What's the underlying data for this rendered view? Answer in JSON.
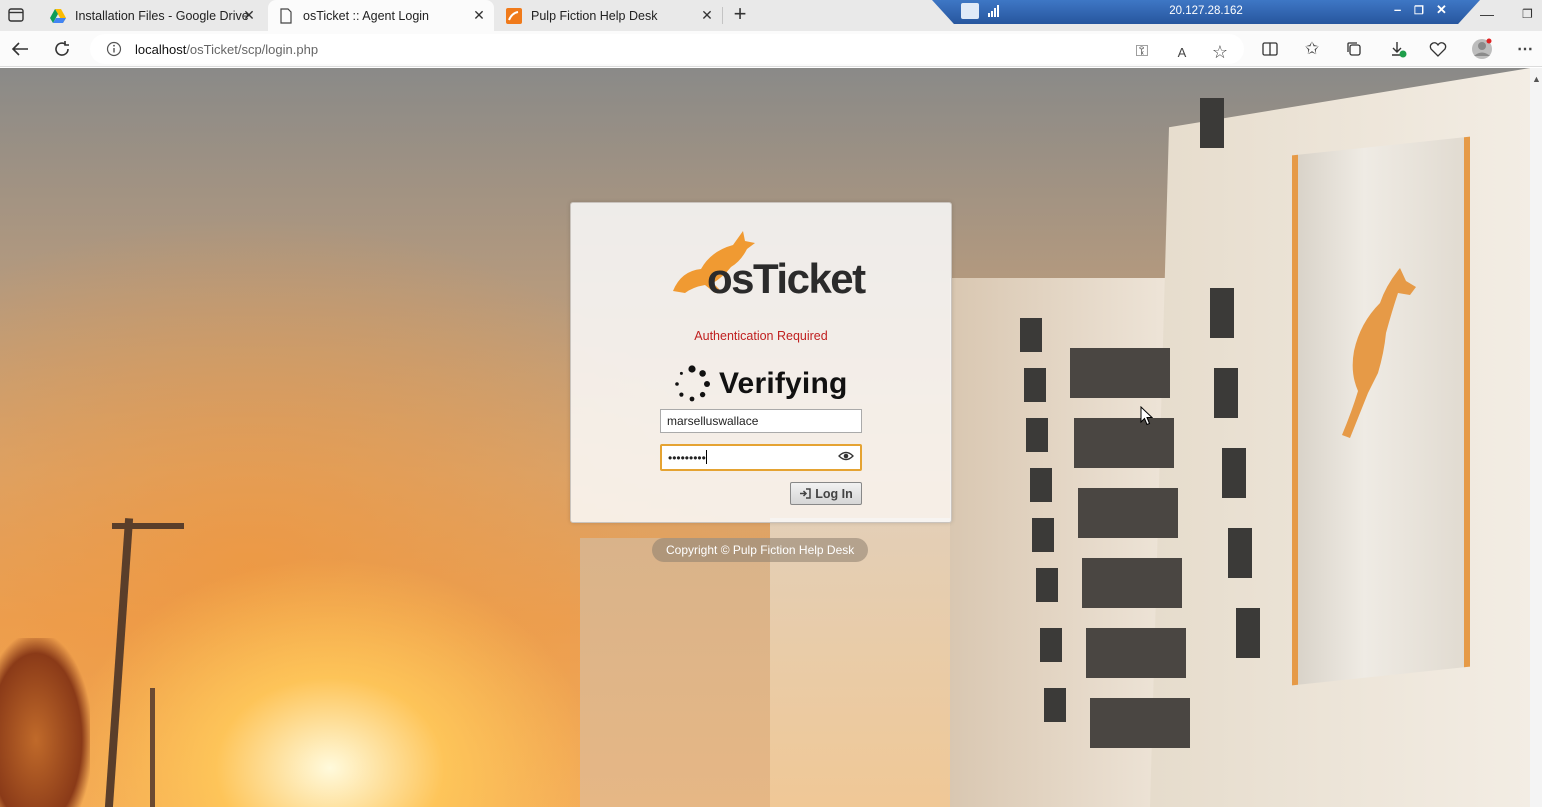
{
  "browser": {
    "tabs": [
      {
        "title": "Installation Files - Google Drive",
        "icon": "google-drive-icon"
      },
      {
        "title": "osTicket :: Agent Login",
        "icon": "page-icon",
        "active": true
      },
      {
        "title": "Pulp Fiction Help Desk",
        "icon": "osticket-favicon"
      }
    ],
    "url_host": "localhost",
    "url_path": "/osTicket/scp/login.php",
    "remote_ip": "20.127.28.162"
  },
  "login": {
    "logo_text": "osTicket",
    "auth_message": "Authentication Required",
    "status_text": "Verifying",
    "username_value": "marselluswallace",
    "password_masked": "•••••••••",
    "login_button": "Log In"
  },
  "footer": {
    "copyright": "Copyright © Pulp Fiction Help Desk"
  },
  "colors": {
    "accent": "#e69a47",
    "auth_red": "#c02020"
  }
}
